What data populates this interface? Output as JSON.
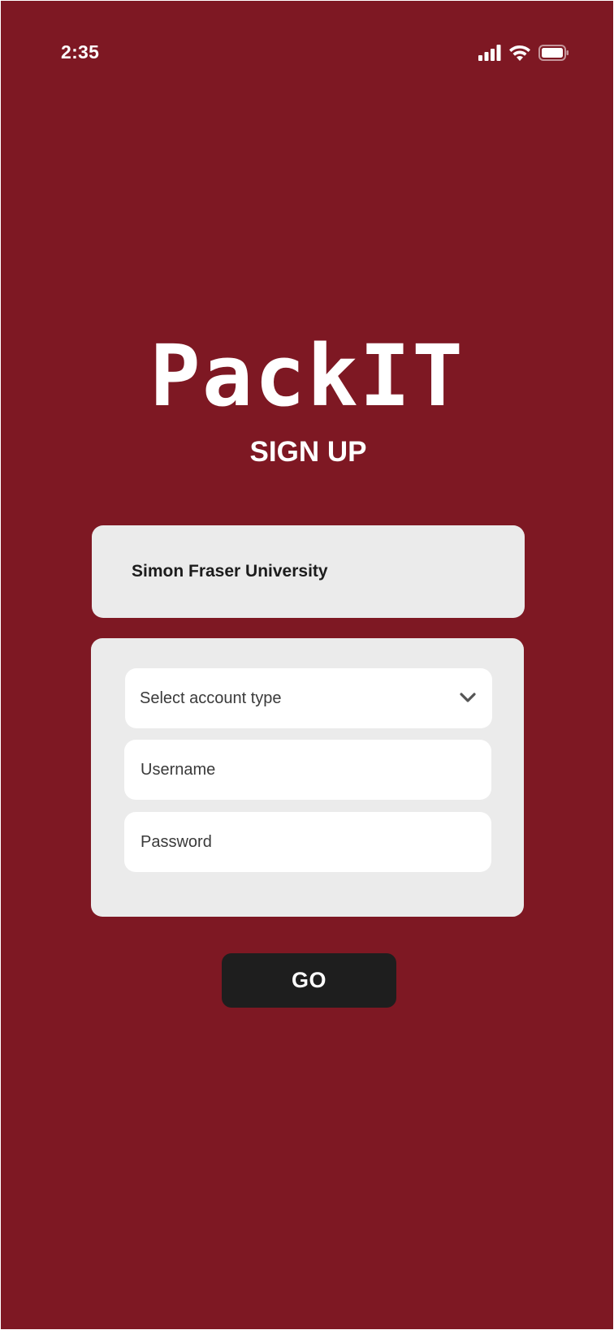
{
  "status_bar": {
    "time": "2:35",
    "icons": [
      "cellular-signal-icon",
      "wifi-icon",
      "battery-icon"
    ]
  },
  "app": {
    "logo_text": "PackIT",
    "subtitle": "SIGN UP"
  },
  "university": {
    "name": "Simon Fraser University"
  },
  "form": {
    "account_type_placeholder": "Select account type",
    "username_placeholder": "Username",
    "password_placeholder": "Password",
    "dropdown_icon": "chevron-down-icon"
  },
  "actions": {
    "go_label": "GO"
  },
  "colors": {
    "background": "#7e1823",
    "panel": "#ebebeb",
    "field": "#ffffff",
    "button": "#1e1e1e",
    "text_light": "#ffffff",
    "text_dark": "#1c1c1c"
  }
}
